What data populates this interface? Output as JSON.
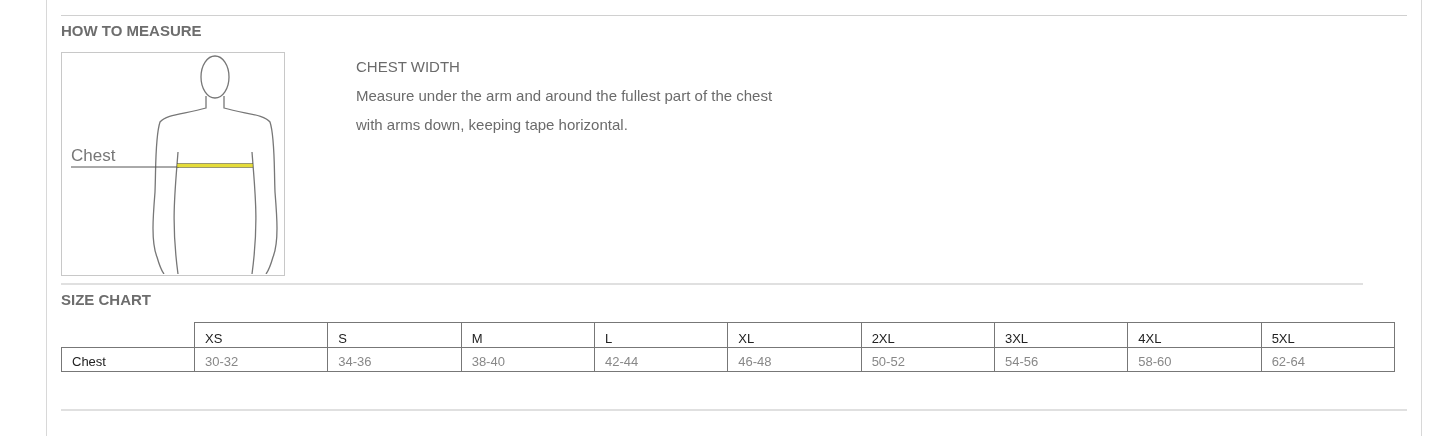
{
  "how_to_measure": {
    "heading": "HOW TO MEASURE",
    "figure_label": "Chest",
    "title": "CHEST WIDTH",
    "lines": [
      "Measure under the arm and around the fullest part of the chest",
      "with arms down, keeping tape horizontal."
    ]
  },
  "size_chart": {
    "heading": "SIZE CHART",
    "columns": [
      "XS",
      "S",
      "M",
      "L",
      "XL",
      "2XL",
      "3XL",
      "4XL",
      "5XL"
    ],
    "rows": [
      {
        "label": "Chest",
        "values": [
          "30-32",
          "34-36",
          "38-40",
          "42-44",
          "46-48",
          "50-52",
          "54-56",
          "58-60",
          "62-64"
        ]
      }
    ]
  }
}
